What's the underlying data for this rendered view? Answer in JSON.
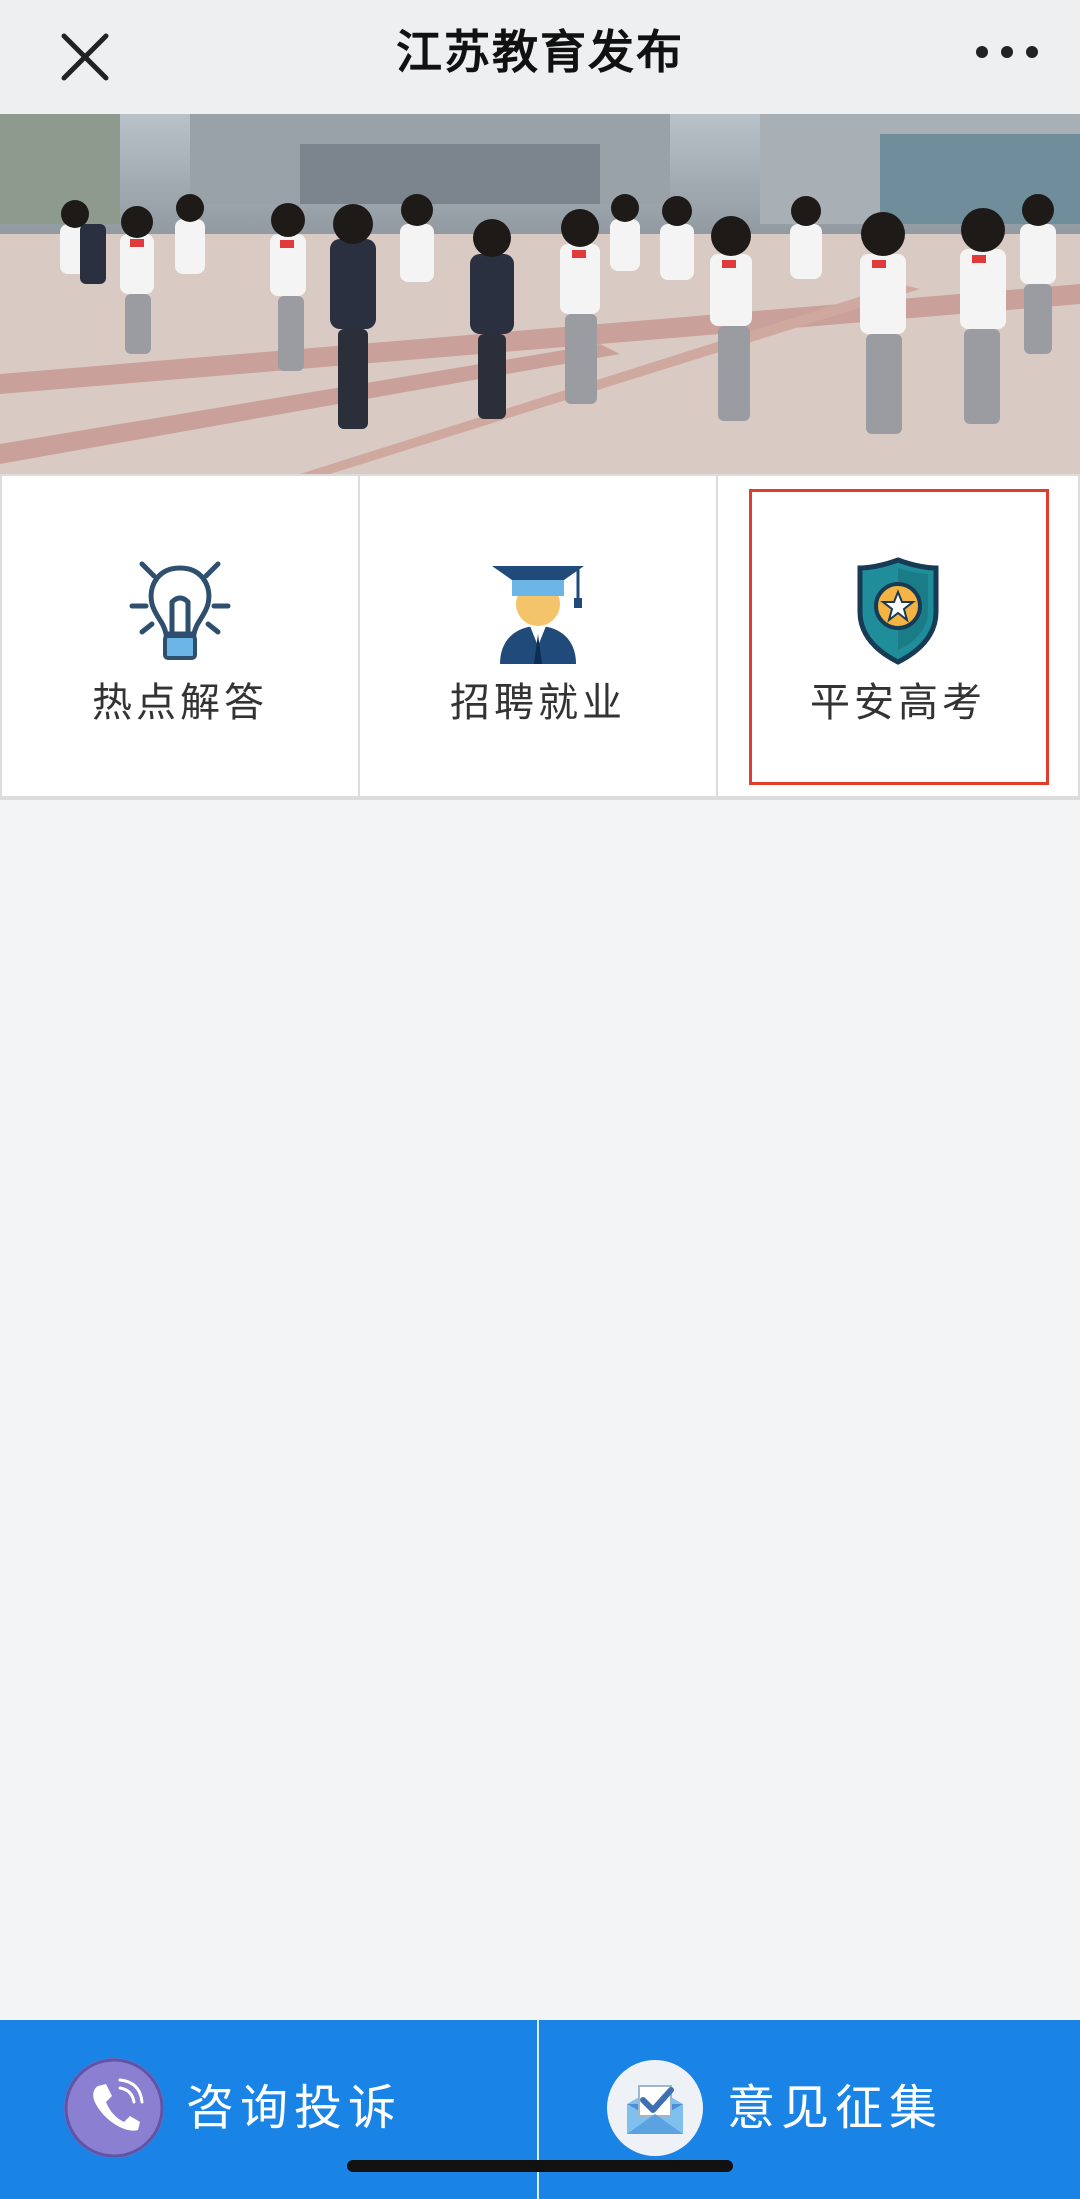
{
  "navbar": {
    "title": "江苏教育发布",
    "close_icon": "close-icon",
    "more_icon": "more-icon"
  },
  "banner": {
    "image": "students-running-photo"
  },
  "cards": [
    {
      "label": "热点解答",
      "icon": "lightbulb-icon"
    },
    {
      "label": "招聘就业",
      "icon": "graduate-icon"
    },
    {
      "label": "平安高考",
      "icon": "shield-star-icon"
    }
  ],
  "bottom_bar": {
    "consult_label": "咨询投诉",
    "feedback_label": "意见征集",
    "consult_icon": "phone-icon",
    "feedback_icon": "mail-check-icon"
  },
  "colors": {
    "accent": "#1a83e6",
    "highlight": "#e53b2a"
  }
}
